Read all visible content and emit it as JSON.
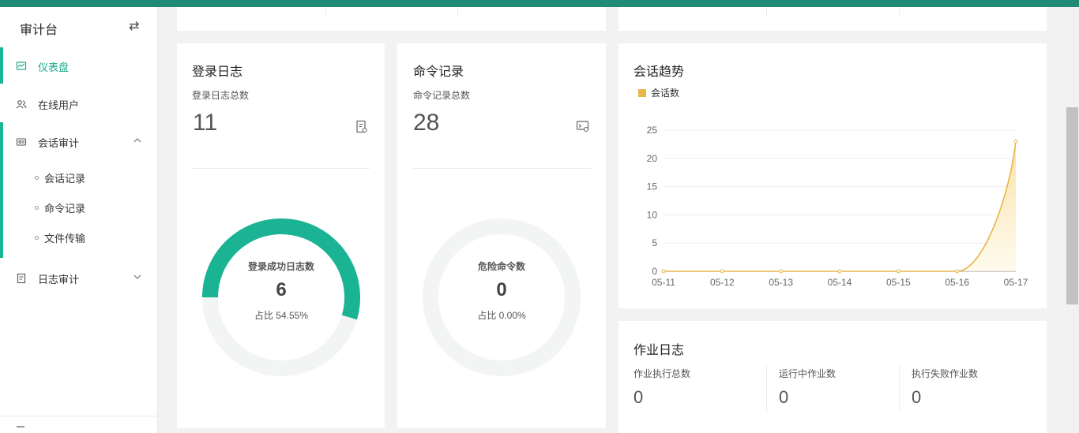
{
  "sidebar": {
    "title": "审计台",
    "toggle_icon": "swap-icon",
    "items": [
      {
        "label": "仪表盘",
        "icon": "dashboard-icon"
      },
      {
        "label": "在线用户",
        "icon": "users-icon"
      },
      {
        "label": "会话审计",
        "icon": "session-icon"
      },
      {
        "label": "日志审计",
        "icon": "log-icon"
      }
    ],
    "sub_items": [
      {
        "label": "会话记录"
      },
      {
        "label": "命令记录"
      },
      {
        "label": "文件传输"
      }
    ],
    "colors": {
      "accent": "#1ab394",
      "topbar": "#1f8b74"
    }
  },
  "login_card": {
    "title": "登录日志",
    "total_label": "登录日志总数",
    "total_value": "11",
    "donut_label": "登录成功日志数",
    "donut_value": "6",
    "donut_percent": "占比 54.55%",
    "fraction": 0.5455,
    "color": "#1ab394"
  },
  "command_card": {
    "title": "命令记录",
    "total_label": "命令记录总数",
    "total_value": "28",
    "donut_label": "危险命令数",
    "donut_value": "0",
    "donut_percent": "占比 0.00%",
    "fraction": 0
  },
  "session_trend": {
    "title": "会话趋势",
    "chart_data": {
      "type": "area",
      "x": [
        "05-11",
        "05-12",
        "05-13",
        "05-14",
        "05-15",
        "05-16",
        "05-17"
      ],
      "series": [
        {
          "name": "会话数",
          "values": [
            0,
            0,
            0,
            0,
            0,
            0,
            23
          ],
          "color": "#e8b64a"
        }
      ],
      "y_ticks": [
        0,
        5,
        10,
        15,
        20,
        25
      ],
      "ylim": [
        0,
        25
      ],
      "grid": true,
      "legend": "top-left"
    }
  },
  "job_log": {
    "title": "作业日志",
    "stats": [
      {
        "label": "作业执行总数",
        "value": "0"
      },
      {
        "label": "运行中作业数",
        "value": "0"
      },
      {
        "label": "执行失败作业数",
        "value": "0"
      }
    ]
  }
}
